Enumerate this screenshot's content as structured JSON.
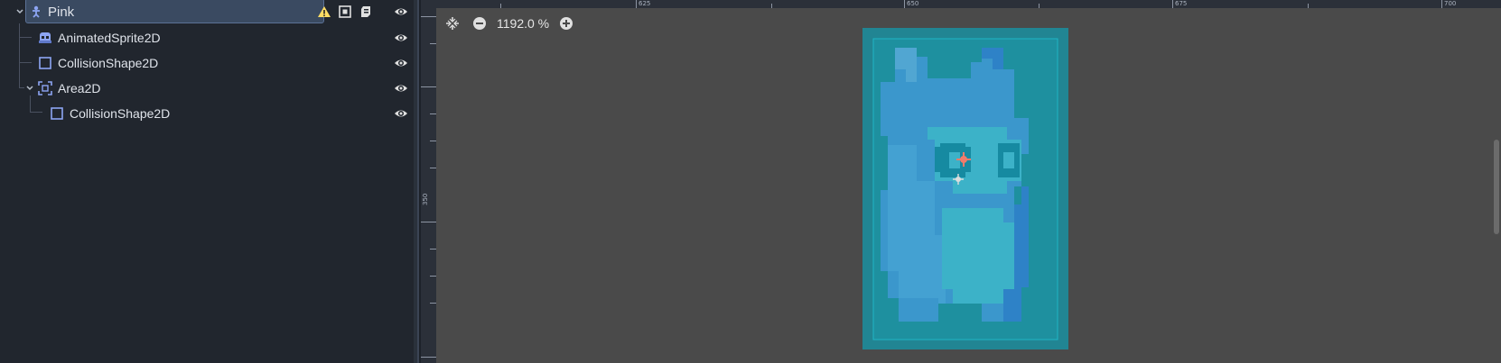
{
  "scene_tree": {
    "nodes": [
      {
        "label": "Pink",
        "icon": "character-body-icon",
        "selected": true,
        "warning": true
      },
      {
        "label": "AnimatedSprite2D",
        "icon": "animated-sprite-icon"
      },
      {
        "label": "CollisionShape2D",
        "icon": "collision-shape-icon"
      },
      {
        "label": "Area2D",
        "icon": "area2d-icon",
        "expanded": true
      },
      {
        "label": "CollisionShape2D",
        "icon": "collision-shape-icon"
      }
    ]
  },
  "viewport": {
    "zoom_label": "1192.0 %",
    "ruler_top_labels": [
      "625",
      "650",
      "675",
      "700"
    ],
    "ruler_left_labels": [
      "350"
    ]
  },
  "colors": {
    "panel_bg": "#21262e",
    "viewport_bg": "#4a4a4a",
    "selection_bg": "#3a4a61",
    "accent": "#5b7196",
    "collision_teal": "#1aa7b8"
  }
}
